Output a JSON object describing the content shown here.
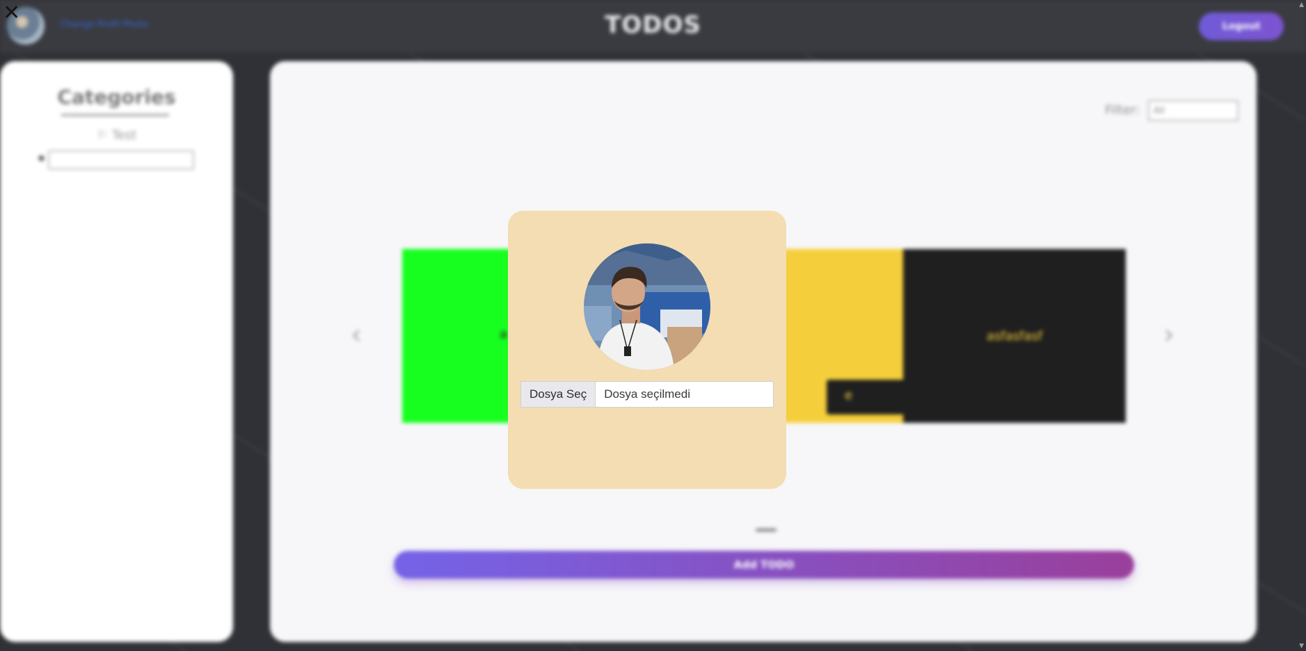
{
  "header": {
    "title": "TODOS",
    "change_photo_label": "Change Profil Photo",
    "logout_label": "Logout"
  },
  "sidebar": {
    "title": "Categories",
    "items": [
      {
        "label": "Test",
        "icon": "flag-icon"
      }
    ],
    "new_category_value": ""
  },
  "main": {
    "filter_label": "Filter:",
    "filter_selected": "All",
    "cards": [
      {
        "text": "a",
        "color": "#16ff1e"
      },
      {
        "text": "e",
        "color": "#f5cf3b"
      },
      {
        "text": "asfasfasf",
        "color": "#1f1f1f"
      }
    ],
    "add_button_label": "Add TODO"
  },
  "modal": {
    "close_icon": "close-icon",
    "file_button_label": "Dosya Seç",
    "file_status": "Dosya seçilmedi"
  },
  "colors": {
    "modal_bg": "#f4ddb2",
    "accent_start": "#7463e8",
    "accent_end": "#9a3f9c"
  }
}
